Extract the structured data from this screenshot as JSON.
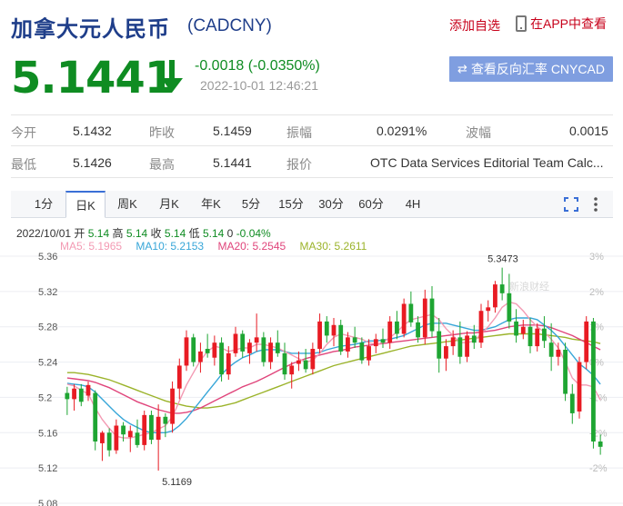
{
  "header": {
    "title": "加拿大元人民币",
    "code": "(CADCNY)",
    "add_favorite": "添加自选",
    "app_view": "在APP中查看"
  },
  "quote": {
    "price": "5.1441",
    "change": "-0.0018 (-0.0350%)",
    "time": "2022-10-01 12:46:21",
    "reverse_button": "查看反向汇率 CNYCAD",
    "direction": "down",
    "down_color": "#0f8c22"
  },
  "stats": {
    "open_label": "今开",
    "open": "5.1432",
    "prev_close_label": "昨收",
    "prev_close": "5.1459",
    "amplitude_label": "振幅",
    "amplitude": "0.0291%",
    "wave_label": "波幅",
    "wave": "0.0015",
    "low_label": "最低",
    "low": "5.1426",
    "high_label": "最高",
    "high": "5.1441",
    "quote_source_label": "报价",
    "quote_source": "OTC Data Services Editorial Team Calc..."
  },
  "tabs": [
    "1分",
    "日K",
    "周K",
    "月K",
    "年K",
    "5分",
    "15分",
    "30分",
    "60分",
    "4H"
  ],
  "active_tab": "日K",
  "chart_info": {
    "date": "2022/10/01",
    "open_label": "开",
    "open": "5.14",
    "high_label": "高",
    "high": "5.14",
    "close_label": "收",
    "close": "5.14",
    "low_label": "低",
    "low": "5.14",
    "zero": "0",
    "pct": "-0.04%",
    "ma5": "MA5: 5.1965",
    "ma10": "MA10: 5.2153",
    "ma20": "MA20: 5.2545",
    "ma30": "MA30: 5.2611",
    "watermark": "新浪财经"
  },
  "colors": {
    "up": "#e81b23",
    "down": "#1ea532",
    "ma5": "#f39ab3",
    "ma10": "#37a6d8",
    "ma20": "#e0457b",
    "ma30": "#9bb32a"
  },
  "chart_data": {
    "type": "candlestick",
    "ylim": [
      5.08,
      5.36
    ],
    "y_ticks": [
      "5.36",
      "5.32",
      "5.28",
      "5.24",
      "5.2",
      "5.16",
      "5.12",
      "5.08"
    ],
    "pct_ticks": [
      "3%",
      "2%",
      "1%",
      "0%",
      "-1%",
      "-2%",
      "-2%"
    ],
    "annotations": {
      "max": "5.3473",
      "min": "5.1169"
    },
    "candles": [
      [
        5.205,
        5.212,
        5.18,
        5.198
      ],
      [
        5.198,
        5.215,
        5.185,
        5.21
      ],
      [
        5.21,
        5.215,
        5.19,
        5.195
      ],
      [
        5.202,
        5.218,
        5.196,
        5.214
      ],
      [
        5.205,
        5.208,
        5.14,
        5.15
      ],
      [
        5.148,
        5.162,
        5.128,
        5.16
      ],
      [
        5.16,
        5.165,
        5.133,
        5.14
      ],
      [
        5.14,
        5.175,
        5.136,
        5.168
      ],
      [
        5.168,
        5.172,
        5.15,
        5.158
      ],
      [
        5.155,
        5.168,
        5.138,
        5.162
      ],
      [
        5.16,
        5.175,
        5.143,
        5.146
      ],
      [
        5.146,
        5.185,
        5.14,
        5.18
      ],
      [
        5.18,
        5.185,
        5.147,
        5.152
      ],
      [
        5.152,
        5.192,
        5.117,
        5.178
      ],
      [
        5.178,
        5.182,
        5.155,
        5.17
      ],
      [
        5.17,
        5.218,
        5.16,
        5.21
      ],
      [
        5.21,
        5.244,
        5.198,
        5.236
      ],
      [
        5.236,
        5.276,
        5.23,
        5.268
      ],
      [
        5.268,
        5.272,
        5.235,
        5.24
      ],
      [
        5.24,
        5.262,
        5.228,
        5.252
      ],
      [
        5.255,
        5.272,
        5.245,
        5.25
      ],
      [
        5.245,
        5.27,
        5.236,
        5.262
      ],
      [
        5.262,
        5.268,
        5.218,
        5.226
      ],
      [
        5.226,
        5.258,
        5.22,
        5.25
      ],
      [
        5.25,
        5.28,
        5.246,
        5.272
      ],
      [
        5.272,
        5.276,
        5.245,
        5.252
      ],
      [
        5.25,
        5.266,
        5.238,
        5.262
      ],
      [
        5.262,
        5.295,
        5.252,
        5.268
      ],
      [
        5.268,
        5.274,
        5.235,
        5.24
      ],
      [
        5.24,
        5.268,
        5.232,
        5.262
      ],
      [
        5.262,
        5.276,
        5.246,
        5.25
      ],
      [
        5.25,
        5.262,
        5.22,
        5.226
      ],
      [
        5.226,
        5.24,
        5.21,
        5.236
      ],
      [
        5.238,
        5.252,
        5.23,
        5.242
      ],
      [
        5.242,
        5.255,
        5.228,
        5.232
      ],
      [
        5.232,
        5.262,
        5.226,
        5.255
      ],
      [
        5.255,
        5.295,
        5.25,
        5.286
      ],
      [
        5.286,
        5.292,
        5.262,
        5.27
      ],
      [
        5.27,
        5.29,
        5.258,
        5.282
      ],
      [
        5.282,
        5.288,
        5.248,
        5.252
      ],
      [
        5.252,
        5.274,
        5.245,
        5.268
      ],
      [
        5.268,
        5.28,
        5.256,
        5.262
      ],
      [
        5.262,
        5.268,
        5.238,
        5.242
      ],
      [
        5.242,
        5.266,
        5.236,
        5.258
      ],
      [
        5.258,
        5.272,
        5.25,
        5.266
      ],
      [
        5.266,
        5.278,
        5.256,
        5.262
      ],
      [
        5.262,
        5.292,
        5.255,
        5.286
      ],
      [
        5.286,
        5.298,
        5.266,
        5.272
      ],
      [
        5.272,
        5.312,
        5.268,
        5.306
      ],
      [
        5.306,
        5.32,
        5.28,
        5.285
      ],
      [
        5.285,
        5.292,
        5.262,
        5.268
      ],
      [
        5.268,
        5.322,
        5.26,
        5.312
      ],
      [
        5.312,
        5.326,
        5.268,
        5.275
      ],
      [
        5.275,
        5.29,
        5.228,
        5.244
      ],
      [
        5.244,
        5.266,
        5.23,
        5.258
      ],
      [
        5.258,
        5.276,
        5.248,
        5.268
      ],
      [
        5.268,
        5.286,
        5.238,
        5.246
      ],
      [
        5.246,
        5.275,
        5.24,
        5.27
      ],
      [
        5.27,
        5.282,
        5.255,
        5.262
      ],
      [
        5.262,
        5.306,
        5.256,
        5.298
      ],
      [
        5.298,
        5.31,
        5.286,
        5.302
      ],
      [
        5.302,
        5.332,
        5.296,
        5.328
      ],
      [
        5.328,
        5.347,
        5.31,
        5.318
      ],
      [
        5.318,
        5.34,
        5.278,
        5.286
      ],
      [
        5.286,
        5.3,
        5.262,
        5.27
      ],
      [
        5.272,
        5.288,
        5.266,
        5.28
      ],
      [
        5.28,
        5.29,
        5.25,
        5.258
      ],
      [
        5.258,
        5.284,
        5.252,
        5.278
      ],
      [
        5.278,
        5.292,
        5.256,
        5.264
      ],
      [
        5.262,
        5.284,
        5.23,
        5.246
      ],
      [
        5.246,
        5.262,
        5.236,
        5.254
      ],
      [
        5.254,
        5.262,
        5.196,
        5.204
      ],
      [
        5.204,
        5.215,
        5.17,
        5.182
      ],
      [
        5.184,
        5.246,
        5.176,
        5.24
      ],
      [
        5.24,
        5.292,
        5.232,
        5.286
      ],
      [
        5.286,
        5.29,
        5.142,
        5.15
      ],
      [
        5.15,
        5.158,
        5.135,
        5.144
      ]
    ],
    "ma": {
      "ma5": [
        5.215,
        5.213,
        5.208,
        5.204,
        5.188,
        5.175,
        5.165,
        5.156,
        5.154,
        5.154,
        5.156,
        5.158,
        5.16,
        5.164,
        5.168,
        5.178,
        5.196,
        5.214,
        5.228,
        5.242,
        5.252,
        5.258,
        5.256,
        5.252,
        5.254,
        5.256,
        5.256,
        5.26,
        5.26,
        5.258,
        5.256,
        5.252,
        5.248,
        5.244,
        5.24,
        5.242,
        5.25,
        5.26,
        5.268,
        5.272,
        5.27,
        5.268,
        5.266,
        5.262,
        5.26,
        5.262,
        5.268,
        5.274,
        5.282,
        5.288,
        5.29,
        5.292,
        5.294,
        5.288,
        5.278,
        5.27,
        5.262,
        5.262,
        5.264,
        5.272,
        5.28,
        5.29,
        5.302,
        5.308,
        5.306,
        5.298,
        5.288,
        5.28,
        5.274,
        5.266,
        5.256,
        5.24,
        5.222,
        5.214,
        5.214,
        5.212,
        5.197
      ],
      "ma10": [
        5.216,
        5.215,
        5.214,
        5.212,
        5.206,
        5.198,
        5.19,
        5.182,
        5.175,
        5.17,
        5.166,
        5.162,
        5.16,
        5.16,
        5.16,
        5.162,
        5.168,
        5.176,
        5.186,
        5.196,
        5.206,
        5.216,
        5.226,
        5.234,
        5.24,
        5.245,
        5.248,
        5.252,
        5.254,
        5.254,
        5.254,
        5.252,
        5.25,
        5.25,
        5.25,
        5.25,
        5.251,
        5.254,
        5.256,
        5.258,
        5.259,
        5.26,
        5.262,
        5.264,
        5.264,
        5.265,
        5.266,
        5.268,
        5.27,
        5.274,
        5.278,
        5.282,
        5.284,
        5.284,
        5.284,
        5.282,
        5.28,
        5.278,
        5.276,
        5.276,
        5.278,
        5.28,
        5.284,
        5.288,
        5.29,
        5.29,
        5.29,
        5.288,
        5.282,
        5.276,
        5.268,
        5.258,
        5.248,
        5.238,
        5.232,
        5.225,
        5.215
      ],
      "ma20": [
        5.222,
        5.221,
        5.22,
        5.219,
        5.217,
        5.214,
        5.211,
        5.207,
        5.203,
        5.199,
        5.195,
        5.192,
        5.189,
        5.186,
        5.184,
        5.182,
        5.182,
        5.183,
        5.185,
        5.188,
        5.192,
        5.196,
        5.2,
        5.204,
        5.208,
        5.212,
        5.215,
        5.218,
        5.222,
        5.226,
        5.23,
        5.234,
        5.238,
        5.241,
        5.244,
        5.246,
        5.248,
        5.25,
        5.252,
        5.253,
        5.255,
        5.257,
        5.258,
        5.259,
        5.26,
        5.261,
        5.262,
        5.263,
        5.264,
        5.265,
        5.266,
        5.267,
        5.268,
        5.269,
        5.27,
        5.271,
        5.272,
        5.273,
        5.273,
        5.274,
        5.275,
        5.276,
        5.278,
        5.28,
        5.281,
        5.282,
        5.282,
        5.282,
        5.281,
        5.279,
        5.276,
        5.273,
        5.27,
        5.266,
        5.262,
        5.258,
        5.254
      ],
      "ma30": [
        5.228,
        5.228,
        5.227,
        5.226,
        5.224,
        5.222,
        5.22,
        5.217,
        5.214,
        5.211,
        5.208,
        5.205,
        5.202,
        5.199,
        5.196,
        5.194,
        5.192,
        5.19,
        5.189,
        5.188,
        5.188,
        5.189,
        5.19,
        5.192,
        5.194,
        5.197,
        5.2,
        5.203,
        5.206,
        5.209,
        5.212,
        5.215,
        5.218,
        5.221,
        5.224,
        5.227,
        5.23,
        5.233,
        5.236,
        5.238,
        5.24,
        5.242,
        5.244,
        5.246,
        5.248,
        5.25,
        5.252,
        5.254,
        5.256,
        5.258,
        5.259,
        5.26,
        5.261,
        5.262,
        5.263,
        5.264,
        5.265,
        5.266,
        5.267,
        5.268,
        5.269,
        5.27,
        5.271,
        5.272,
        5.272,
        5.272,
        5.272,
        5.272,
        5.271,
        5.27,
        5.269,
        5.268,
        5.266,
        5.265,
        5.264,
        5.263,
        5.261
      ]
    }
  }
}
